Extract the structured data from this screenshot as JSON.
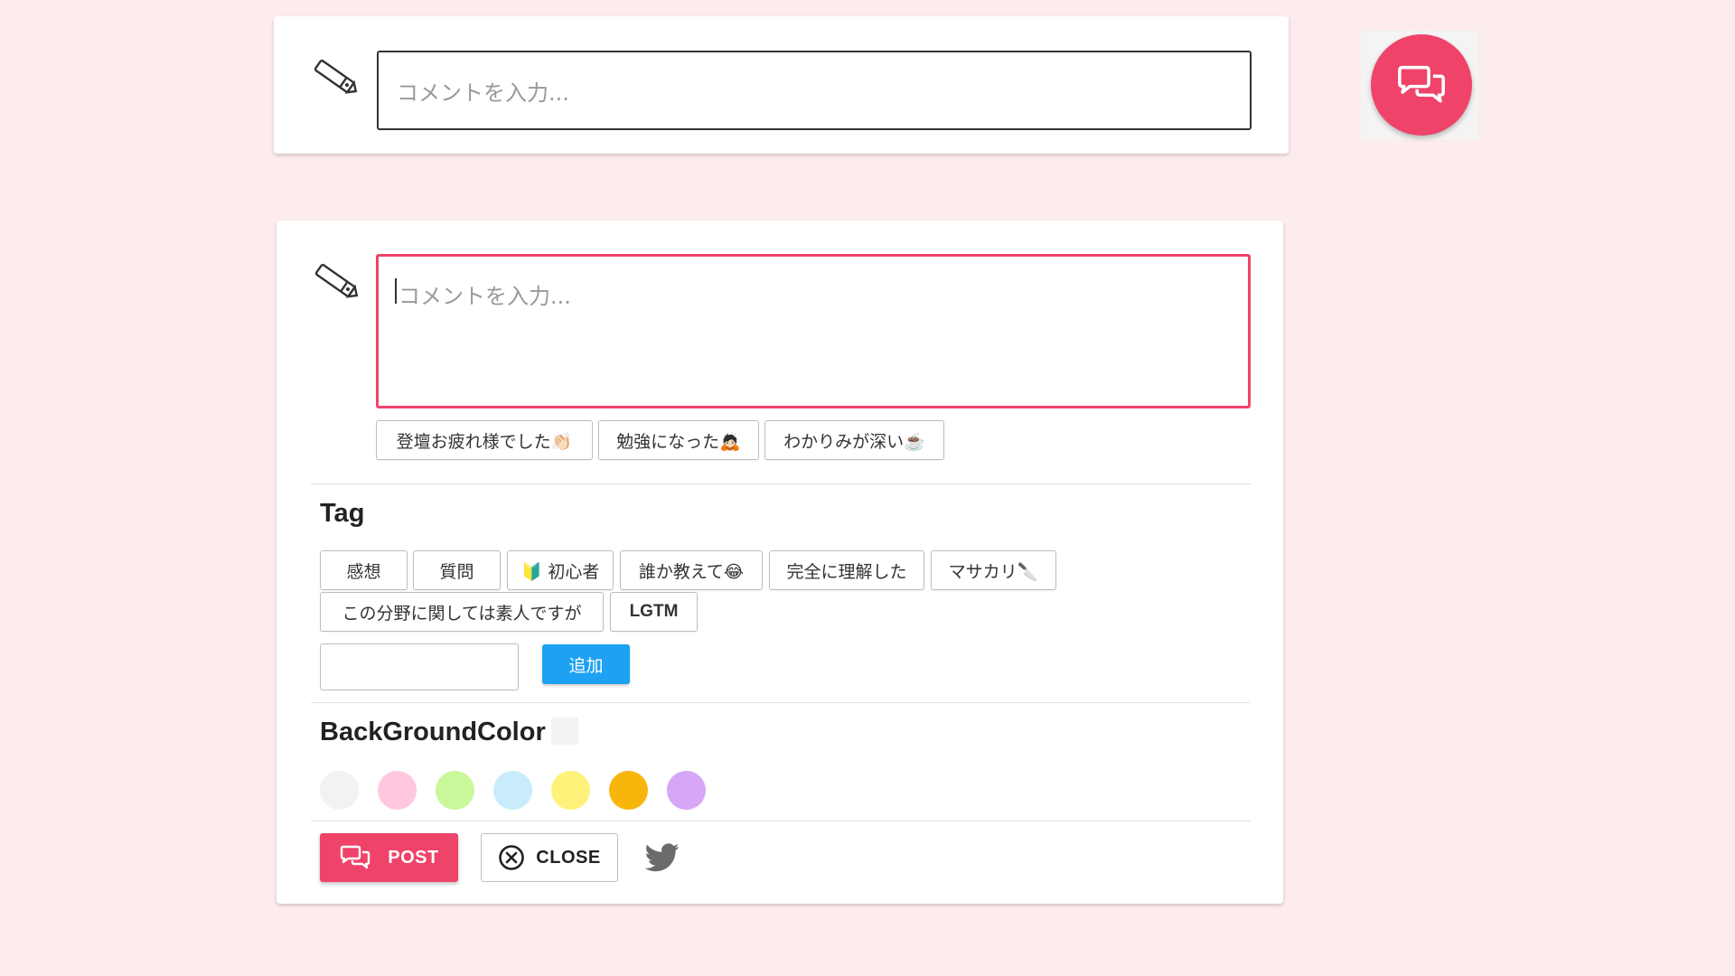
{
  "top_card": {
    "comment_placeholder": "コメントを入力..."
  },
  "main_card": {
    "comment_placeholder": "コメントを入力...",
    "quick_replies": [
      {
        "label": "登壇お疲れ様でした👏🏻"
      },
      {
        "label": "勉強になった🙇🏻"
      },
      {
        "label": "わかりみが深い☕️"
      }
    ],
    "tag_section": {
      "title": "Tag",
      "tags": [
        {
          "label": "感想"
        },
        {
          "label": "質問"
        },
        {
          "label": "🔰 初心者"
        },
        {
          "label": "誰か教えて😂"
        },
        {
          "label": "完全に理解した"
        },
        {
          "label": "マサカリ🔪"
        },
        {
          "label": "この分野に関しては素人ですが"
        },
        {
          "label": "LGTM"
        }
      ],
      "new_tag_value": "",
      "add_label": "追加"
    },
    "bg_section": {
      "title": "BackGroundColor",
      "swatches": [
        "#f2f2f2",
        "#ffc8e0",
        "#c9f79a",
        "#c8ecfb",
        "#fff27a",
        "#f8b60d",
        "#d6a6f7"
      ]
    },
    "actions": {
      "post_label": "POST",
      "close_label": "CLOSE"
    }
  },
  "colors": {
    "accent": "#f0436a",
    "add_button": "#1ea1f2",
    "page_bg": "#fdeced"
  }
}
